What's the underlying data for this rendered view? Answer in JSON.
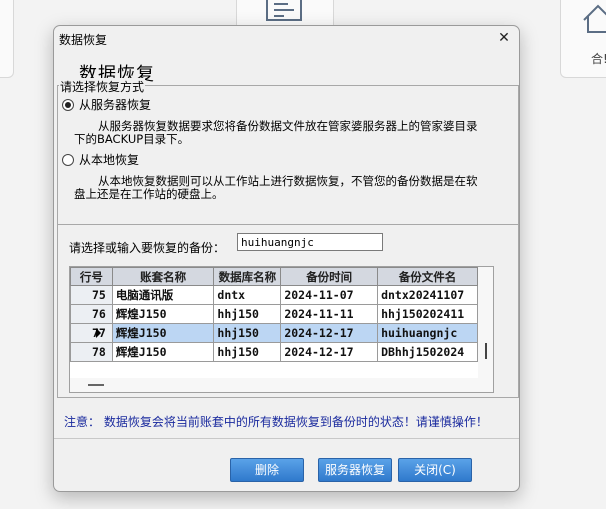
{
  "background": {
    "right_label": "合!"
  },
  "dialog": {
    "title": "数据恢复",
    "close_glyph": "✕",
    "heading": "数据恢复",
    "recover_group": {
      "legend": "请选择恢复方式",
      "option_server": "从服务器恢复",
      "option_server_desc_1": "从服务器恢复数据要求您将备份数据文件放在管家婆服务器上的管家婆目录",
      "option_server_desc_2": "下的BACKUP目录下。",
      "option_local": "从本地恢复",
      "option_local_desc_1": "从本地恢复数据则可以从工作站上进行数据恢复，不管您的备份数据是在软",
      "option_local_desc_2": "盘上还是在工作站的硬盘上。",
      "selected": "server"
    },
    "backup": {
      "label": "请选择或输入要恢复的备份：",
      "input_value": "huihuangnjc"
    },
    "grid": {
      "columns": [
        "行号",
        "账套名称",
        "数据库名称",
        "备份时间",
        "备份文件名"
      ],
      "rows": [
        {
          "row": "75",
          "account": "电脑通讯版",
          "db": "dntx",
          "time": "2024-11-07",
          "file": "dntx20241107"
        },
        {
          "row": "76",
          "account": "辉煌J150",
          "db": "hhj150",
          "time": "2024-11-11",
          "file": "hhj150202411"
        },
        {
          "row": "77",
          "account": "辉煌J150",
          "db": "hhj150",
          "time": "2024-12-17",
          "file": "huihuangnjc"
        },
        {
          "row": "78",
          "account": "辉煌J150",
          "db": "hhj150",
          "time": "2024-12-17",
          "file": "DBhhj1502024"
        }
      ],
      "selected_row": "77"
    },
    "note": "注意：  数据恢复会将当前账套中的所有数据恢复到备份时的状态！请谨慎操作！",
    "buttons": {
      "delete": "删除",
      "server_restore": "服务器恢复",
      "close": "关闭(C)"
    },
    "colors": {
      "button_blue": "#3b86d8",
      "note_blue": "#1a2a9e",
      "selected_row": "#bcd6f3"
    }
  }
}
